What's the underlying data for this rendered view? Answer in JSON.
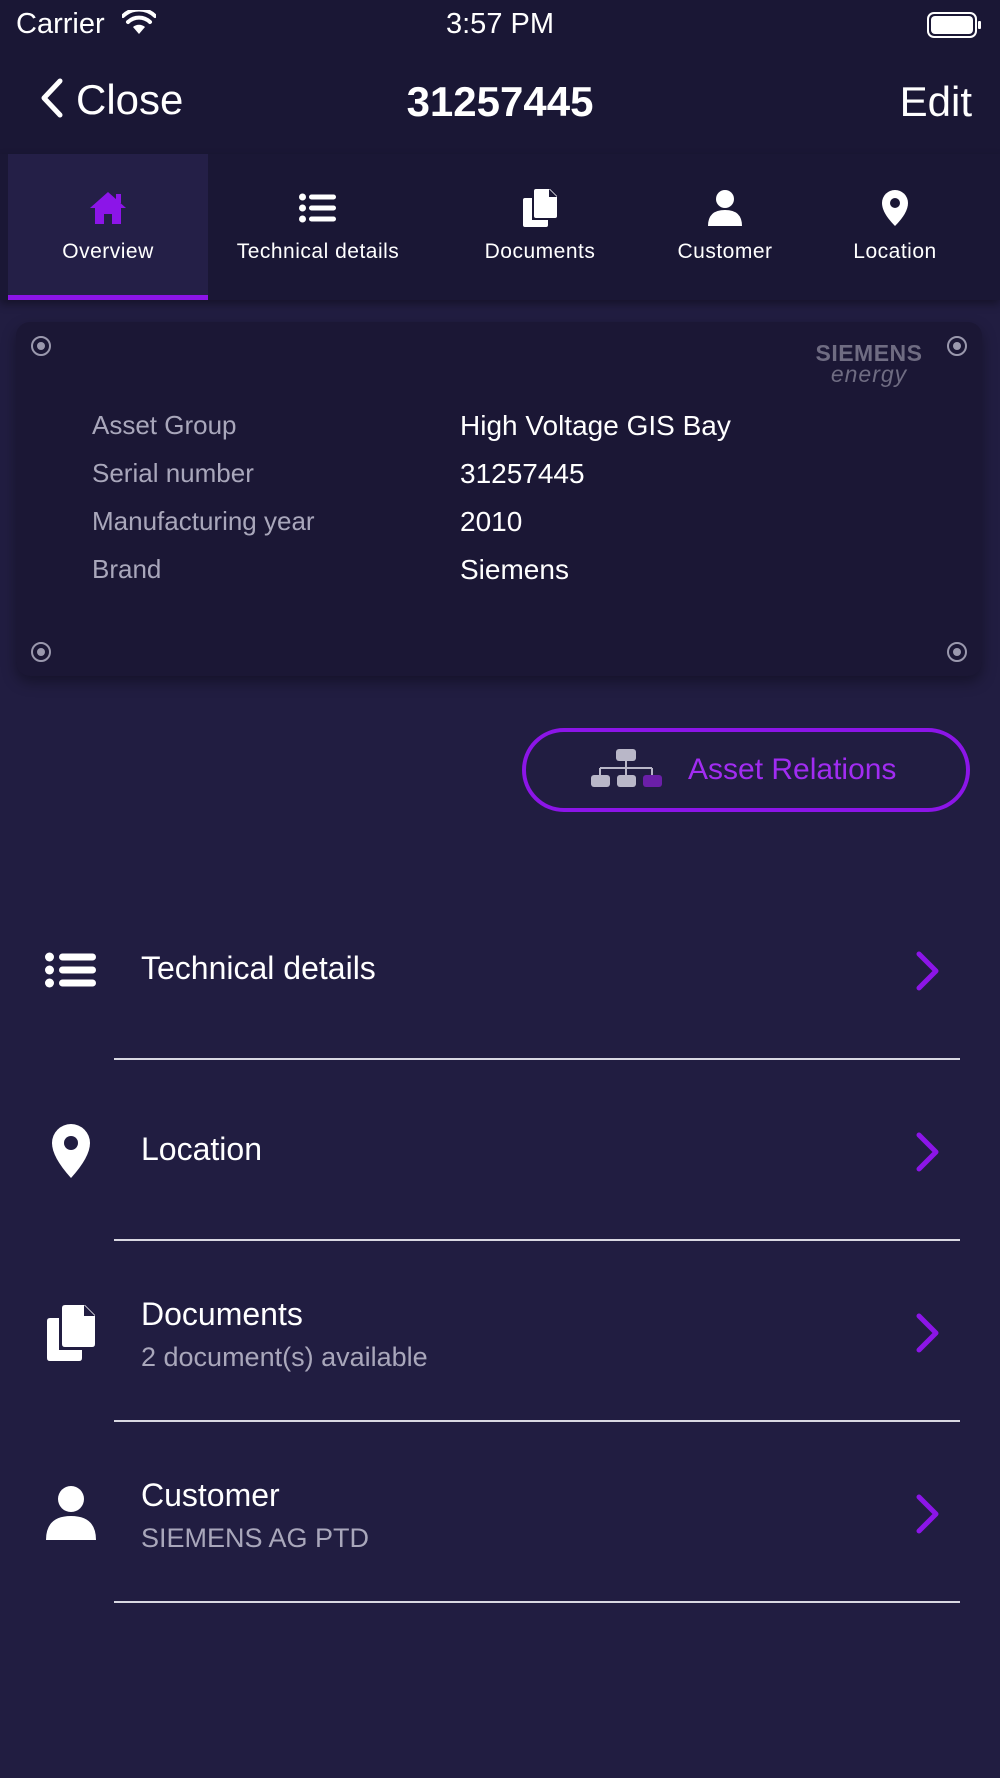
{
  "status_bar": {
    "carrier": "Carrier",
    "time": "3:57 PM"
  },
  "nav": {
    "close_label": "Close",
    "title": "31257445",
    "edit_label": "Edit"
  },
  "tabs": [
    {
      "label": "Overview",
      "icon": "home-icon",
      "active": true
    },
    {
      "label": "Technical details",
      "icon": "list-icon",
      "active": false
    },
    {
      "label": "Documents",
      "icon": "documents-icon",
      "active": false
    },
    {
      "label": "Customer",
      "icon": "person-icon",
      "active": false
    },
    {
      "label": "Location",
      "icon": "location-pin-icon",
      "active": false
    }
  ],
  "asset_card": {
    "brand_logo": {
      "line1": "SIEMENS",
      "line2": "energy"
    },
    "rows": [
      {
        "label": "Asset Group",
        "value": "High Voltage GIS Bay"
      },
      {
        "label": "Serial number",
        "value": "31257445"
      },
      {
        "label": "Manufacturing year",
        "value": "2010"
      },
      {
        "label": "Brand",
        "value": "Siemens"
      }
    ]
  },
  "asset_relations": {
    "label": "Asset Relations",
    "icon": "hierarchy-icon"
  },
  "list": [
    {
      "title": "Technical details",
      "subtitle": "",
      "icon": "list-icon"
    },
    {
      "title": "Location",
      "subtitle": "",
      "icon": "location-pin-icon"
    },
    {
      "title": "Documents",
      "subtitle": "2 document(s) available",
      "icon": "documents-icon"
    },
    {
      "title": "Customer",
      "subtitle": "SIEMENS AG PTD",
      "icon": "person-icon"
    }
  ],
  "colors": {
    "background": "#211d41",
    "bar_background": "#1a1735",
    "accent": "#8c15e8",
    "muted_text": "#a9a7bb"
  }
}
